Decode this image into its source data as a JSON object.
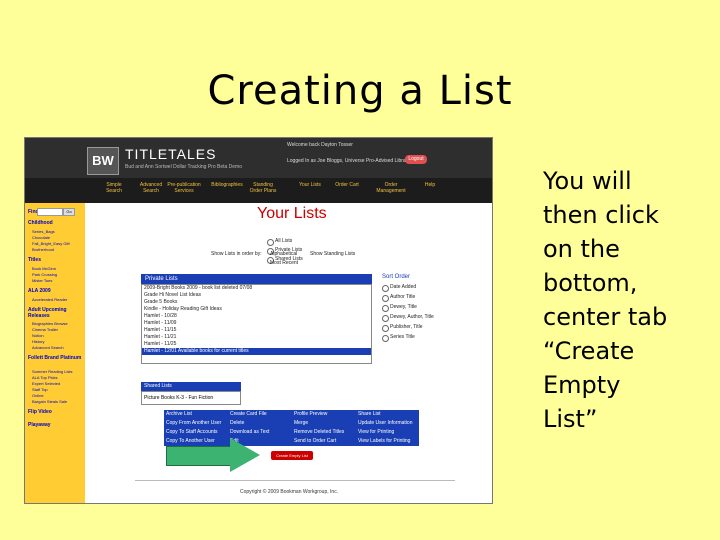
{
  "slide": {
    "title": "Creating a List",
    "instruction": "You will\nthen click\non the\nbottom,\ncenter tab\n“Create\nEmpty\nList”"
  },
  "app": {
    "logo_mark": "BW",
    "logo_text": "TITLETALES",
    "logo_subtext": "Bud and Ann Sortwel Dollar Tracking Pro Beta Demo",
    "welcome": "Welcome back Dayton Tosser",
    "account": "Logged In as Joe Bloggs, Universe Pro-Advised Library",
    "logout": "Logout"
  },
  "nav": {
    "items": [
      "Simple\nSearch",
      "Advanced\nSearch",
      "Pre-publication\nServices",
      "Bibliographies",
      "Standing\nOrder Plans",
      "Your Lists",
      "Order Cart",
      "Order\nManagement",
      "Help"
    ]
  },
  "sidebar": {
    "find_label": "Find",
    "go": "Go",
    "sections": [
      {
        "heading": "Childhood",
        "items": [
          "Series_Bags",
          "Chocolate",
          "Fall_Bright_Easy Gift",
          "Brotherhood"
        ]
      },
      {
        "heading": "Titles",
        "items": [
          "Book McGinn",
          "Park Crossing",
          "Mister Toes"
        ]
      },
      {
        "heading": "ALA 2009",
        "items": [
          "Accelerated Reader"
        ]
      },
      {
        "heading": "Adult Upcoming Releases",
        "items": [
          "Biographies Browse",
          "Cinema Trailer",
          "Notion",
          "History",
          "Advanced Search"
        ]
      },
      {
        "heading": "Follett Brand Platinum",
        "items": [
          "Summer Reading Lists",
          "ALA Top Picks",
          "Expert Selected",
          "Staff Top",
          "Online",
          "Bargain Steals Sale"
        ]
      },
      {
        "heading": "Flip Video",
        "items": []
      },
      {
        "heading": "Playaway",
        "items": []
      }
    ]
  },
  "page": {
    "title": "Your Lists",
    "list_type_options": [
      "All Lists",
      "Private Lists",
      "Shared Lists"
    ],
    "sort_by_label": "Show Lists in order by:",
    "sort_by_options": [
      "Alphabetical",
      "Most Recent"
    ],
    "show_dropdown": "Show Standing Lists"
  },
  "private_lists": {
    "heading": "Private Lists",
    "rows": [
      "2009-Bright Books 2009 - book list deleted 07/08",
      "Grade Hi Novel List Ideas",
      "Grade 5 Books",
      "Kindle - Holiday Reading Gift Ideas",
      "Hamlet - 10/28",
      "Hamlet - 11/09",
      "Hamlet - 11/15",
      "Hamlet - 11/21",
      "Hamlet - 11/25",
      "Hamlet - 12/01 Available books for current titles"
    ]
  },
  "sort_order": {
    "heading": "Sort Order",
    "options": [
      "Date Added",
      "Author Title",
      "Dewey, Title",
      "Dewey, Author, Title",
      "Publisher, Title",
      "Series Title"
    ]
  },
  "shared_lists": {
    "heading": "Shared Lists",
    "rows": [
      "Picture Books K-3 - Fun Fiction"
    ]
  },
  "actions": {
    "columns": [
      [
        "Archive List",
        "Copy From Another User",
        "Copy To Staff Accounts",
        "Copy To Another User"
      ],
      [
        "Create Card File",
        "Delete",
        "Download as Text",
        "Edit"
      ],
      [
        "Profile Preview",
        "Merge",
        "Remove Deleted Titles",
        "Send to Order Cart"
      ],
      [
        "Share List",
        "Update User Information",
        "View for Printing",
        "View Labels for Printing"
      ]
    ],
    "create_empty_list": "Create Empty List"
  },
  "footer": {
    "copyright": "Copyright © 2009 Bookman Workgroup, Inc."
  }
}
